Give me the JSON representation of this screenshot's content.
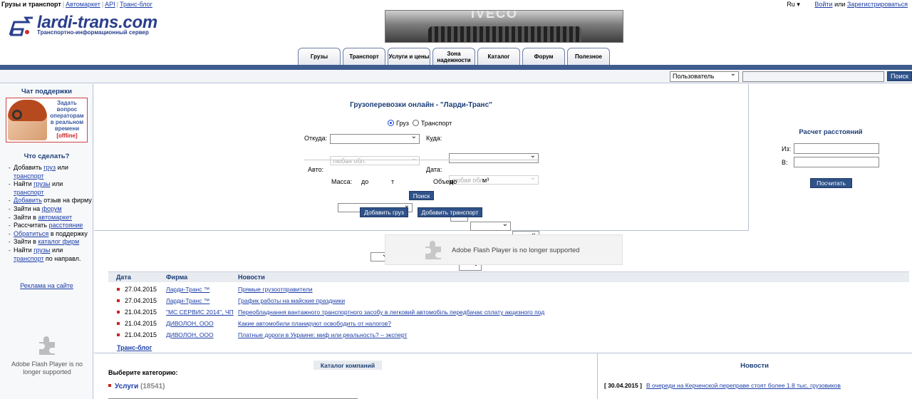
{
  "topline": {
    "brand": "Грузы и транспорт",
    "links": [
      "Автомаркет",
      "API",
      "Транс-блог"
    ]
  },
  "topright": {
    "lang": "Ru ▾",
    "login": "Войти",
    "or": "или",
    "register": "Зарегистрироваться"
  },
  "logo": {
    "name": "lardi-trans.com",
    "subtitle": "Транспортно-информационный сервер"
  },
  "banner": {
    "text": "IVECO"
  },
  "tabs": [
    {
      "label": "Грузы"
    },
    {
      "label": "Транспорт"
    },
    {
      "label": "Услуги и цены"
    },
    {
      "label": "Зона надежности"
    },
    {
      "label": "Каталог"
    },
    {
      "label": "Форум"
    },
    {
      "label": "Полезное"
    }
  ],
  "search": {
    "selected": "Пользователь",
    "button": "Поиск"
  },
  "left": {
    "chat_title": "Чат поддержки",
    "chat_text": "Задать вопрос операторам в реальном времени",
    "chat_status": "[offline]",
    "todo_title": "Что сделать?",
    "adv": "Реклама на сайте",
    "flash": "Adobe Flash Player is no longer supported"
  },
  "form": {
    "title": "Грузоперевозки онлайн - \"Ларди-Транс\"",
    "radio_cargo": "Груз",
    "radio_transport": "Транспорт",
    "from": "Откуда:",
    "to": "Куда:",
    "any_region": "любая обл.",
    "auto": "Авто:",
    "date": "Дата:",
    "mass": "Масса:",
    "mass_to": "до",
    "mass_unit": "т",
    "volume": "Объем:",
    "volume_to": "до",
    "volume_unit": "м³",
    "search_btn": "Поиск",
    "add_cargo": "Добавить груз",
    "add_transport": "Добавить транспорт"
  },
  "distance": {
    "title": "Расчет расстояний",
    "from": "Из:",
    "to": "В:",
    "button": "Посчитать"
  },
  "flash_mid": "Adobe Flash Player is no longer supported",
  "news": {
    "headers": {
      "date": "Дата",
      "firm": "Фирма",
      "news": "Новости"
    },
    "rows": [
      {
        "date": "27.04.2015",
        "firm": "Ларди-Транс ™",
        "title": "Прямые грузоотправители"
      },
      {
        "date": "27.04.2015",
        "firm": "Ларди-Транс ™",
        "title": "График работы на майские праздники"
      },
      {
        "date": "21.04.2015",
        "firm": "\"МС СЕРВИС 2014\", ЧП",
        "title": "Переобладнання вантажного транспортного засобу в легковий автомобіль передбачає сплату акцизного под"
      },
      {
        "date": "21.04.2015",
        "firm": "ДИВОЛОН, ООО",
        "title": "Какие автомобили планируют освободить от налогов?"
      },
      {
        "date": "21.04.2015",
        "firm": "ДИВОЛОН, ООО",
        "title": "Платные дороги в Украине: миф или реальность? – эксперт"
      }
    ],
    "blog": "Транс-блог"
  },
  "catalog": {
    "header": "Каталог компаний",
    "choose": "Выберите категорию:",
    "cat1_label": "Услуги",
    "cat1_count": "(18541)"
  },
  "news_right": {
    "header": "Новости",
    "items": [
      {
        "date": "[ 30.04.2015 ]",
        "title": "В очереди на Керченской переправе стоят более 1.8 тыс. грузовиков"
      }
    ]
  },
  "colors": {
    "brand_blue": "#2a3f8c",
    "bar_blue": "#3e5c8e",
    "link": "#1c3ea8",
    "bullet_red": "#cc2222"
  }
}
